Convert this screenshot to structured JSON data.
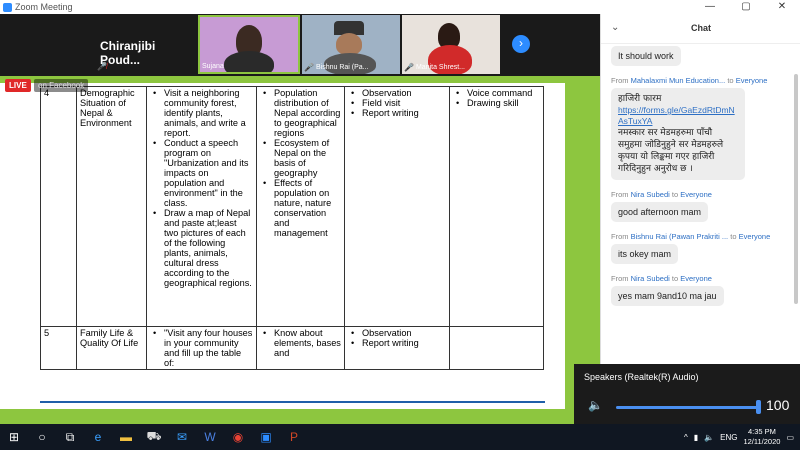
{
  "window": {
    "title": "Zoom Meeting",
    "controls": [
      "—",
      "▢",
      "✕"
    ]
  },
  "participants": [
    {
      "name": "Chiranjibi  Poud..."
    },
    {
      "name": "Sujana"
    },
    {
      "name": "Bishnu Rai (Pa..."
    },
    {
      "name": "Manita Shrest..."
    }
  ],
  "badges": {
    "live": "LIVE",
    "facebook": "on Facebook"
  },
  "slide": {
    "row4": {
      "num": "4",
      "topic": "Demographic Situation of Nepal & Environment",
      "activities": [
        "Visit a neighboring community forest, identify plants, animals, and write a report.",
        "Conduct a speech program on \"Urbanization and its impacts on population and environment\" in the class.",
        "Draw a map of Nepal and paste at;least two pictures of each of the following plants, animals, cultural dress according to the geographical regions."
      ],
      "content": [
        "Population distribution of Nepal according to geographical regions",
        "Ecosystem of Nepal on the basis of geography",
        "Effects of population on nature, nature conservation and management"
      ],
      "methods": [
        "Observation",
        "Field visit",
        "Report writing"
      ],
      "skills": [
        "Voice command",
        "Drawing skill"
      ]
    },
    "row5": {
      "num": "5",
      "topic": "Family Life & Quality Of Life",
      "activities": [
        "\"Visit any four houses in your community and fill up the table of:"
      ],
      "content": [
        "Know about elements, bases and"
      ],
      "methods": [
        "Observation",
        "Report writing"
      ],
      "skills": []
    }
  },
  "chat": {
    "title": "Chat",
    "messages": [
      {
        "from": "",
        "to": "",
        "text": "It should work"
      },
      {
        "from": "Mahalaxmi Mun Education...",
        "to": "Everyone",
        "line1": "हाजिरी फारम",
        "link": "https://forms.gle/GaEzdRtDmNAsTuxYA",
        "line2": "नमस्कार सर मेडमहरुमा पाँचौ समुहमा जोडिनुहुने सर मेडमहरुले कृपया यो लिङ्कमा गएर हाजिरी गरिदिनुहुन अनुरोध छ ।"
      },
      {
        "from": "Nira Subedi",
        "to": "Everyone",
        "text": "good afternoon mam"
      },
      {
        "from": "Bishnu Rai (Pawan Prakriti ...",
        "to": "Everyone",
        "text": "its okey mam"
      },
      {
        "from": "Nira Subedi",
        "to": "Everyone",
        "text": "yes mam 9and10 ma jau"
      }
    ],
    "to_label": "to"
  },
  "audio": {
    "device": "Speakers (Realtek(R) Audio)",
    "volume": "100",
    "volume_fraction": 1.0
  },
  "taskbar": {
    "lang": "ENG",
    "time": "4:35 PM",
    "date": "12/11/2020"
  }
}
